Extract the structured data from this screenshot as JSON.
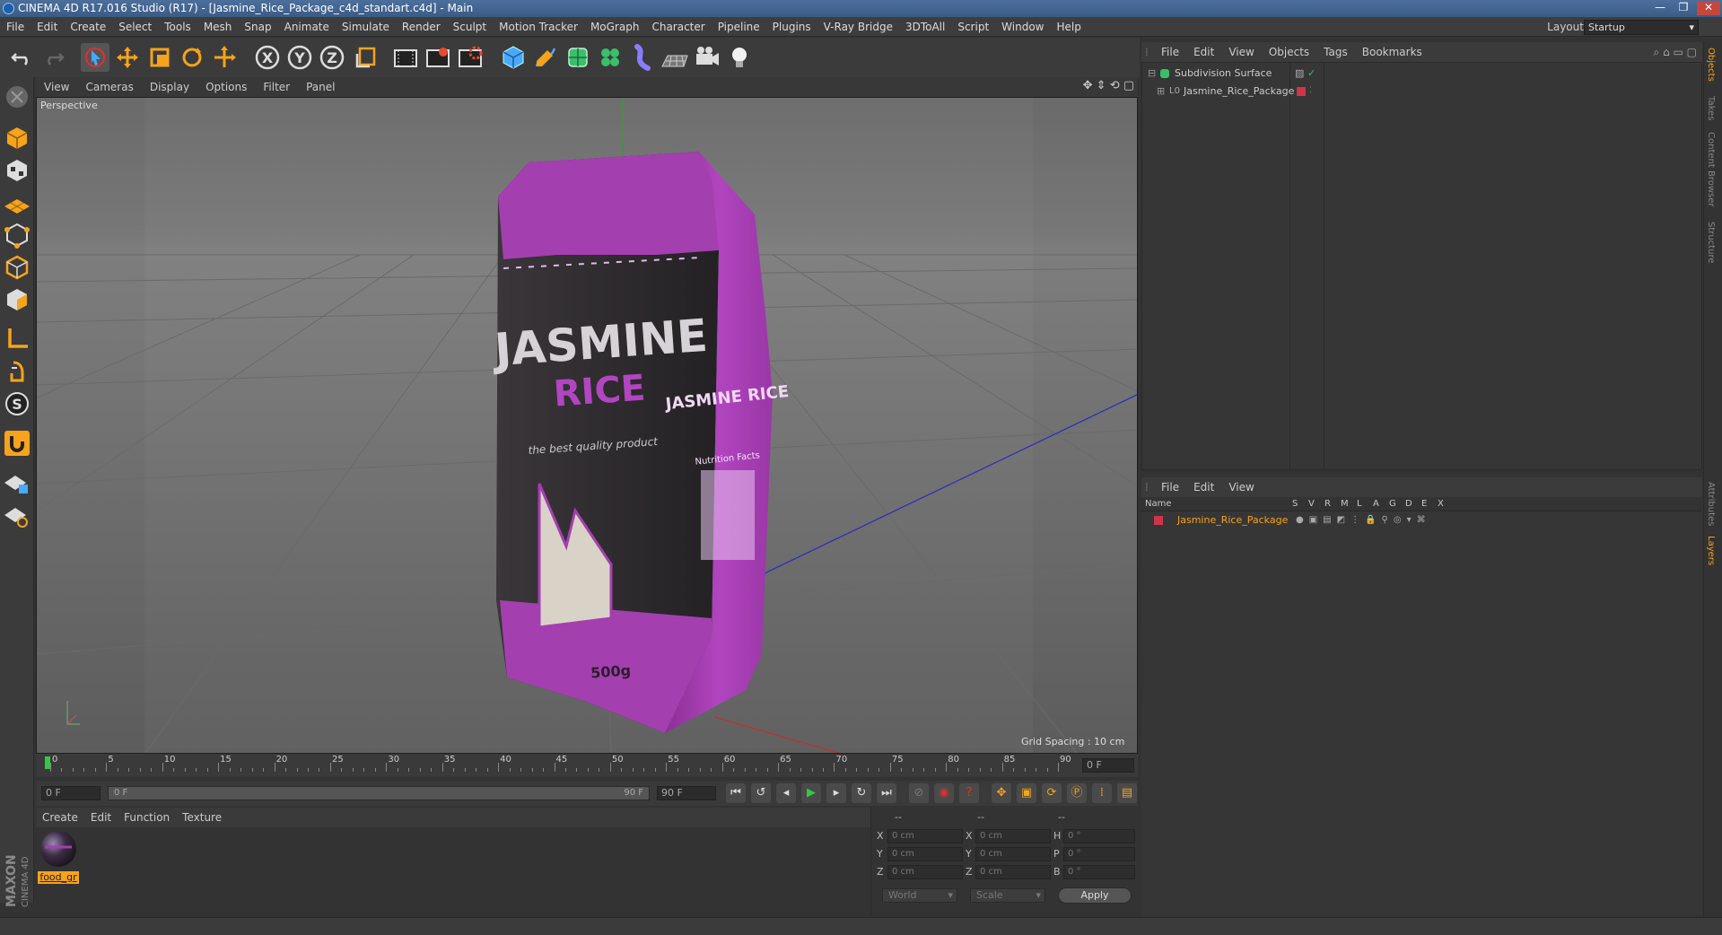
{
  "window": {
    "title": "CINEMA 4D R17.016 Studio (R17) - [Jasmine_Rice_Package_c4d_standart.c4d] - Main",
    "controls": [
      "—",
      "❐",
      "✕"
    ]
  },
  "menubar": {
    "items": [
      "File",
      "Edit",
      "Create",
      "Select",
      "Tools",
      "Mesh",
      "Snap",
      "Animate",
      "Simulate",
      "Render",
      "Sculpt",
      "Motion Tracker",
      "MoGraph",
      "Character",
      "Pipeline",
      "Plugins",
      "V-Ray Bridge",
      "3DToAll",
      "Script",
      "Window",
      "Help"
    ],
    "layout_label": "Layout:",
    "layout_value": "Startup"
  },
  "toolbar": {
    "icons": [
      "undo-icon",
      "redo-icon",
      "live-selection-icon",
      "move-icon",
      "scale-icon",
      "rotate-icon",
      "transform-icon",
      "x-axis-icon",
      "y-axis-icon",
      "z-axis-icon",
      "coordinate-system-icon",
      "render-view-icon",
      "render-picture-viewer-icon",
      "edit-render-settings-icon",
      "cube-object-icon",
      "pen-spline-icon",
      "subdivision-surface-icon",
      "cloner-icon",
      "deformer-icon",
      "floor-environment-icon",
      "camera-icon",
      "light-icon"
    ]
  },
  "viewport": {
    "menu": [
      "View",
      "Cameras",
      "Display",
      "Options",
      "Filter",
      "Panel"
    ],
    "label": "Perspective",
    "grid_spacing": "Grid Spacing : 10 cm",
    "package_title": "JASMINE",
    "package_subtitle": "RICE",
    "package_tagline": "the best quality product",
    "package_weight": "500g",
    "side_title": "JASMINE RICE",
    "side_label": "Nutrition Facts"
  },
  "timeline": {
    "ticks": [
      "0",
      "5",
      "10",
      "15",
      "20",
      "25",
      "30",
      "35",
      "40",
      "45",
      "50",
      "55",
      "60",
      "65",
      "70",
      "75",
      "80",
      "85",
      "90"
    ],
    "current_frame": "0 F",
    "start_field": "0 F",
    "range_start": "0 F",
    "range_end": "90 F",
    "end_field": "90 F"
  },
  "material_manager": {
    "menu": [
      "Create",
      "Edit",
      "Function",
      "Texture"
    ],
    "materials": [
      {
        "name": "food_gr"
      }
    ]
  },
  "coordinates": {
    "headers": [
      "--",
      "--",
      "--"
    ],
    "rows": [
      {
        "a": "X",
        "av": "0 cm",
        "b": "X",
        "bv": "0 cm",
        "c": "H",
        "cv": "0 °"
      },
      {
        "a": "Y",
        "av": "0 cm",
        "b": "Y",
        "bv": "0 cm",
        "c": "P",
        "cv": "0 °"
      },
      {
        "a": "Z",
        "av": "0 cm",
        "b": "Z",
        "bv": "0 cm",
        "c": "B",
        "cv": "0 °"
      }
    ],
    "space": "World",
    "mode": "Scale",
    "apply": "Apply"
  },
  "object_manager": {
    "menu": [
      "File",
      "Edit",
      "View",
      "Objects",
      "Tags",
      "Bookmarks"
    ],
    "objects": [
      {
        "name": "Subdivision Surface",
        "icon": "subdivision-surface-icon"
      },
      {
        "name": "Jasmine_Rice_Package",
        "icon": "polygon-object-icon"
      }
    ]
  },
  "layer_manager": {
    "menu": [
      "File",
      "Edit",
      "View"
    ],
    "columns": [
      "Name",
      "S",
      "V",
      "R",
      "M",
      "L",
      "A",
      "G",
      "D",
      "E",
      "X"
    ],
    "layers": [
      {
        "name": "Jasmine_Rice_Package",
        "color": "#d0344a"
      }
    ]
  },
  "side_tabs": [
    "Objects",
    "Takes",
    "Content Browser",
    "Structure",
    "Attributes",
    "Layers"
  ],
  "branding": {
    "logo": "MAXON",
    "product": "CINEMA 4D"
  },
  "colors": {
    "accent": "#f7a31b",
    "selection": "#e8851a",
    "layer_red": "#d0344a",
    "package_purple": "#a43fb0"
  }
}
